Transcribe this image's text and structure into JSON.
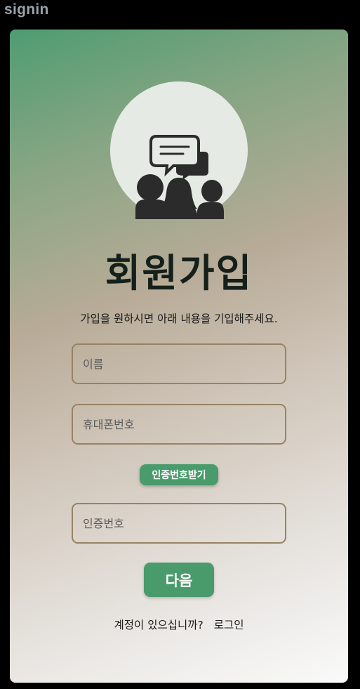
{
  "window": {
    "label": "signin"
  },
  "page": {
    "title": "회원가입",
    "subtitle": "가입을 원하시면 아래 내용을 기입해주세요."
  },
  "form": {
    "name_placeholder": "이름",
    "phone_placeholder": "휴대폰번호",
    "request_code_label": "인증번호받기",
    "code_placeholder": "인증번호",
    "next_label": "다음"
  },
  "footer": {
    "prompt": "계정이 있으십니까?",
    "login_link": "로그인"
  },
  "icons": {
    "avatar": "group-chat-icon"
  },
  "colors": {
    "accent": "#4a9b6c",
    "field_border": "#978264",
    "title": "#15201b"
  }
}
